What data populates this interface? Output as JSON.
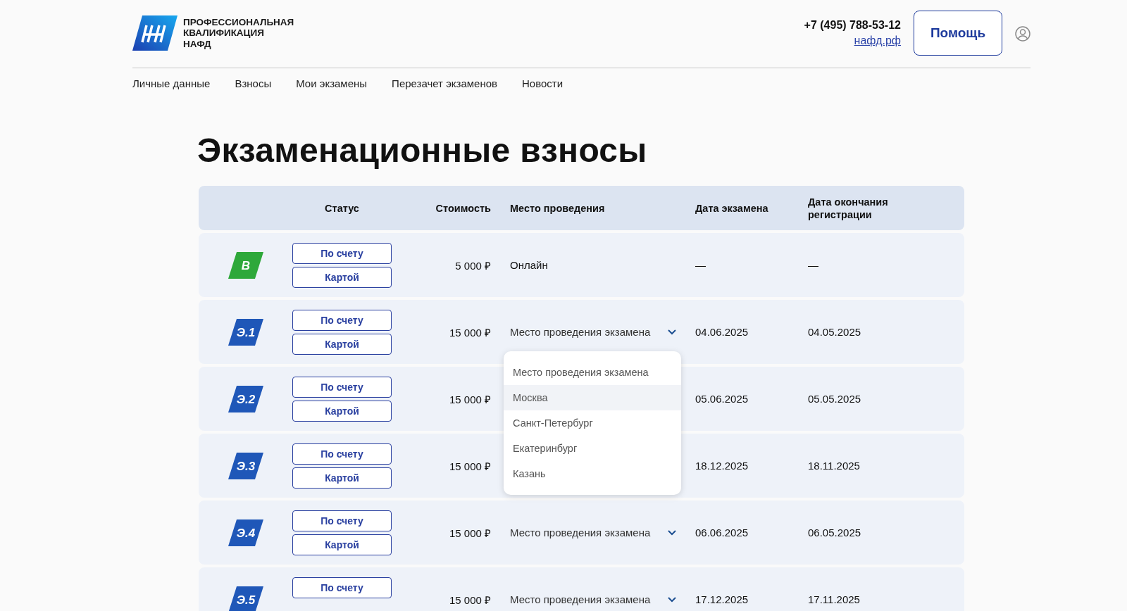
{
  "logo": {
    "text_lines": [
      "ПРОФЕССИОНАЛЬНАЯ",
      "КВАЛИФИКАЦИЯ",
      "НАФД"
    ]
  },
  "contacts": {
    "phone": "+7 (495) 788-53-12",
    "site": "нафд.рф"
  },
  "help_button": "Помощь",
  "nav": [
    "Личные данные",
    "Взносы",
    "Мои экзамены",
    "Перезачет экзаменов",
    "Новости"
  ],
  "title": "Экзаменационные взносы",
  "table": {
    "columns": [
      "Статус",
      "Стоимость",
      "Место проведения",
      "Дата экзамена",
      "Дата окончания регистрации"
    ],
    "rows": [
      {
        "badge": "B",
        "color": "#2ea83a",
        "buttons": [
          "По счету",
          "Картой"
        ],
        "cost": "5 000 ₽",
        "place": {
          "kind": "text",
          "text": "Онлайн"
        },
        "exam_date": "—",
        "reg_date": "—"
      },
      {
        "badge": "Э.1",
        "color": "#1f57b8",
        "buttons": [
          "По счету",
          "Картой"
        ],
        "cost": "15 000 ₽",
        "place": {
          "kind": "select",
          "text": "Место проведения экзамена",
          "expanded": true,
          "options": [
            {
              "label": "Место проведения экзамена",
              "highlighted": false
            },
            {
              "label": "Москва",
              "highlighted": true
            },
            {
              "label": "Санкт-Петербург",
              "highlighted": false
            },
            {
              "label": "Екатеринбург",
              "highlighted": false
            },
            {
              "label": "Казань",
              "highlighted": false
            }
          ]
        },
        "exam_date": "04.06.2025",
        "reg_date": "04.05.2025"
      },
      {
        "badge": "Э.2",
        "color": "#1f57b8",
        "buttons": [
          "По счету",
          "Картой"
        ],
        "cost": "15 000 ₽",
        "exam_date": "05.06.2025",
        "reg_date": "05.05.2025"
      },
      {
        "badge": "Э.3",
        "color": "#1f57b8",
        "buttons": [
          "По счету",
          "Картой"
        ],
        "cost": "15 000 ₽",
        "exam_date": "18.12.2025",
        "reg_date": "18.11.2025"
      },
      {
        "badge": "Э.4",
        "color": "#1f57b8",
        "buttons": [
          "По счету",
          "Картой"
        ],
        "cost": "15 000 ₽",
        "place": {
          "kind": "select",
          "text": "Место проведения экзамена"
        },
        "exam_date": "06.06.2025",
        "reg_date": "06.05.2025"
      },
      {
        "badge": "Э.5",
        "color": "#1f57b8",
        "buttons": [
          "По счету"
        ],
        "cost": "15 000 ₽",
        "place": {
          "kind": "select",
          "text": "Место проведения экзамена"
        },
        "exam_date": "17.12.2025",
        "reg_date": "17.11.2025"
      }
    ]
  }
}
